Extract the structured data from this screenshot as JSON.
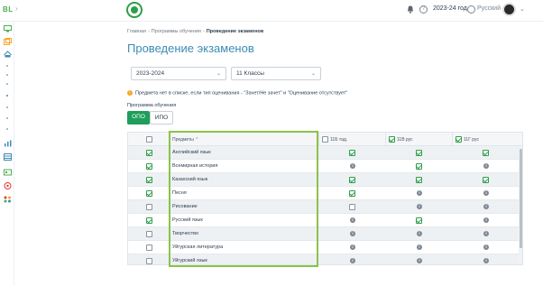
{
  "header": {
    "brand": "BL",
    "year": "2023-24 год",
    "language": "Русский"
  },
  "breadcrumb": {
    "items": [
      "Главная",
      "Программы обучения",
      "Проведение экзаменов"
    ]
  },
  "page_title": "Проведение экзаменов",
  "filters": {
    "year_value": "2023-2024",
    "class_value": "11 Классы"
  },
  "notice": "Предмета нет в списке, если тип оценивания - \"Зачет/Не зачет\" и \"Оценивание отсутствует\"",
  "program": {
    "label": "Программа обучения",
    "options": [
      "ОПО",
      "ИПО"
    ],
    "selected": "ОПО"
  },
  "table": {
    "headers": {
      "subjects": "Предметы",
      "col1": "11Б тад.",
      "col2": "11В рус",
      "col3": "11Г рус"
    },
    "rows": [
      {
        "name": "Английский язык",
        "checked": true,
        "c1": "check",
        "c2": "check",
        "c3": "check"
      },
      {
        "name": "Всемирная история",
        "checked": true,
        "c1": "info",
        "c2": "check",
        "c3": "info"
      },
      {
        "name": "Казахский язык",
        "checked": true,
        "c1": "check",
        "c2": "check",
        "c3": "check"
      },
      {
        "name": "Песня",
        "checked": true,
        "c1": "check",
        "c2": "info",
        "c3": "info"
      },
      {
        "name": "Рисование",
        "checked": false,
        "c1": "empty",
        "c2": "info",
        "c3": "info"
      },
      {
        "name": "Русский язык",
        "checked": true,
        "c1": "info",
        "c2": "check",
        "c3": "info"
      },
      {
        "name": "Творчество",
        "checked": false,
        "c1": "info",
        "c2": "info",
        "c3": "info"
      },
      {
        "name": "Уйгурская литература",
        "checked": false,
        "c1": "info",
        "c2": "info",
        "c3": "info"
      },
      {
        "name": "Уйгурский язык",
        "checked": false,
        "c1": "info",
        "c2": "info",
        "c3": "info"
      }
    ]
  },
  "colors": {
    "accent": "#1e9e5a",
    "title": "#3c8cb4",
    "highlight": "#8bc34a"
  }
}
